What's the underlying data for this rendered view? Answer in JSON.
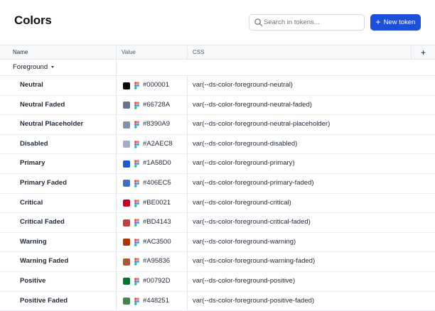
{
  "header": {
    "title": "Colors",
    "search_placeholder": "Search in tokens...",
    "new_button_label": "New token"
  },
  "table": {
    "columns": {
      "name": "Name",
      "value": "Value",
      "css": "CSS",
      "add": "+"
    },
    "group": {
      "label": "Foreground"
    },
    "rows": [
      {
        "name": "Neutral",
        "hex": "#000001",
        "css": "var(--ds-color-foreground-neutral)"
      },
      {
        "name": "Neutral Faded",
        "hex": "#66728A",
        "css": "var(--ds-color-foreground-neutral-faded)"
      },
      {
        "name": "Neutral Placeholder",
        "hex": "#8390A9",
        "css": "var(--ds-color-foreground-neutral-placeholder)"
      },
      {
        "name": "Disabled",
        "hex": "#A2AEC8",
        "css": "var(--ds-color-foreground-disabled)"
      },
      {
        "name": "Primary",
        "hex": "#1A58D0",
        "css": "var(--ds-color-foreground-primary)"
      },
      {
        "name": "Primary Faded",
        "hex": "#406EC5",
        "css": "var(--ds-color-foreground-primary-faded)"
      },
      {
        "name": "Critical",
        "hex": "#BE0021",
        "css": "var(--ds-color-foreground-critical)"
      },
      {
        "name": "Critical Faded",
        "hex": "#BD4143",
        "css": "var(--ds-color-foreground-critical-faded)"
      },
      {
        "name": "Warning",
        "hex": "#AC3500",
        "css": "var(--ds-color-foreground-warning)"
      },
      {
        "name": "Warning Faded",
        "hex": "#A95836",
        "css": "var(--ds-color-foreground-warning-faded)"
      },
      {
        "name": "Positive",
        "hex": "#00792D",
        "css": "var(--ds-color-foreground-positive)"
      },
      {
        "name": "Positive Faded",
        "hex": "#448251",
        "css": "var(--ds-color-foreground-positive-faded)"
      }
    ]
  },
  "colors": {
    "accent": "#1D4FD8",
    "figma_red": "#F24E1E",
    "figma_orange": "#FF7262",
    "figma_purple": "#A259FF",
    "figma_blue": "#1ABCFE",
    "figma_green": "#0ACF83"
  }
}
